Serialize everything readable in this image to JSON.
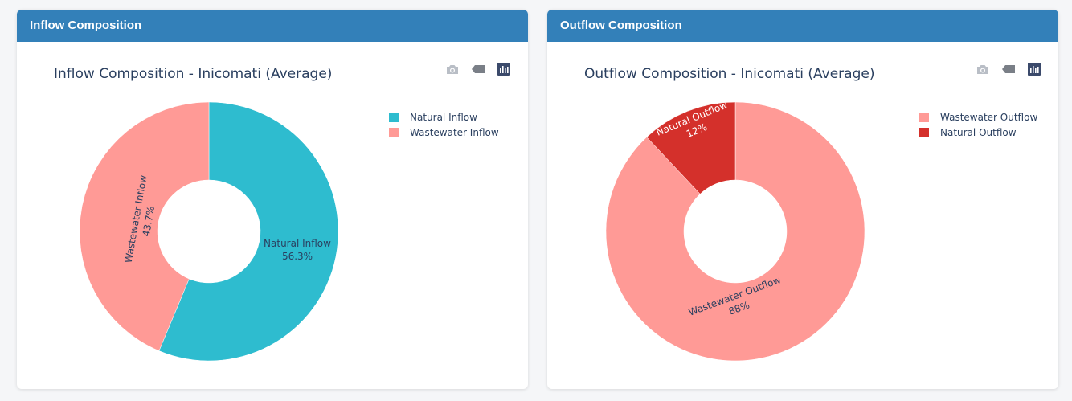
{
  "colors": {
    "header_bg": "#3380b9",
    "natural_inflow": "#2ebccf",
    "wastewater": "#ff9a96",
    "natural_outflow": "#d4302b",
    "modebar_icon": "#b9bec6",
    "modebar_active": "#3b4a6b"
  },
  "modebar": {
    "icons": [
      "camera-icon",
      "tag-icon",
      "bar-chart-icon"
    ]
  },
  "inflow_card": {
    "header": "Inflow Composition",
    "chart_title": "Inflow Composition - Inicomati (Average)",
    "legend": [
      "Natural Inflow",
      "Wastewater Inflow"
    ],
    "labels": {
      "natural_name": "Natural Inflow",
      "natural_pct": "56.3%",
      "wastewater_name": "Wastewater Inflow",
      "wastewater_pct": "43.7%"
    }
  },
  "outflow_card": {
    "header": "Outflow Composition",
    "chart_title": "Outflow Composition - Inicomati (Average)",
    "legend": [
      "Wastewater Outflow",
      "Natural Outflow"
    ],
    "labels": {
      "wastewater_name": "Wastewater Outflow",
      "wastewater_pct": "88%",
      "natural_name": "Natural Outflow",
      "natural_pct": "12%"
    }
  },
  "chart_data": [
    {
      "type": "pie",
      "title": "Inflow Composition - Inicomati (Average)",
      "hole": true,
      "legend_placement": "top-right",
      "slices": [
        {
          "label": "Natural Inflow",
          "value": 56.3,
          "color": "#2ebccf"
        },
        {
          "label": "Wastewater Inflow",
          "value": 43.7,
          "color": "#ff9a96"
        }
      ]
    },
    {
      "type": "pie",
      "title": "Outflow Composition - Inicomati (Average)",
      "hole": true,
      "legend_placement": "top-right",
      "slices": [
        {
          "label": "Wastewater Outflow",
          "value": 88,
          "color": "#ff9a96"
        },
        {
          "label": "Natural Outflow",
          "value": 12,
          "color": "#d4302b"
        }
      ]
    }
  ]
}
